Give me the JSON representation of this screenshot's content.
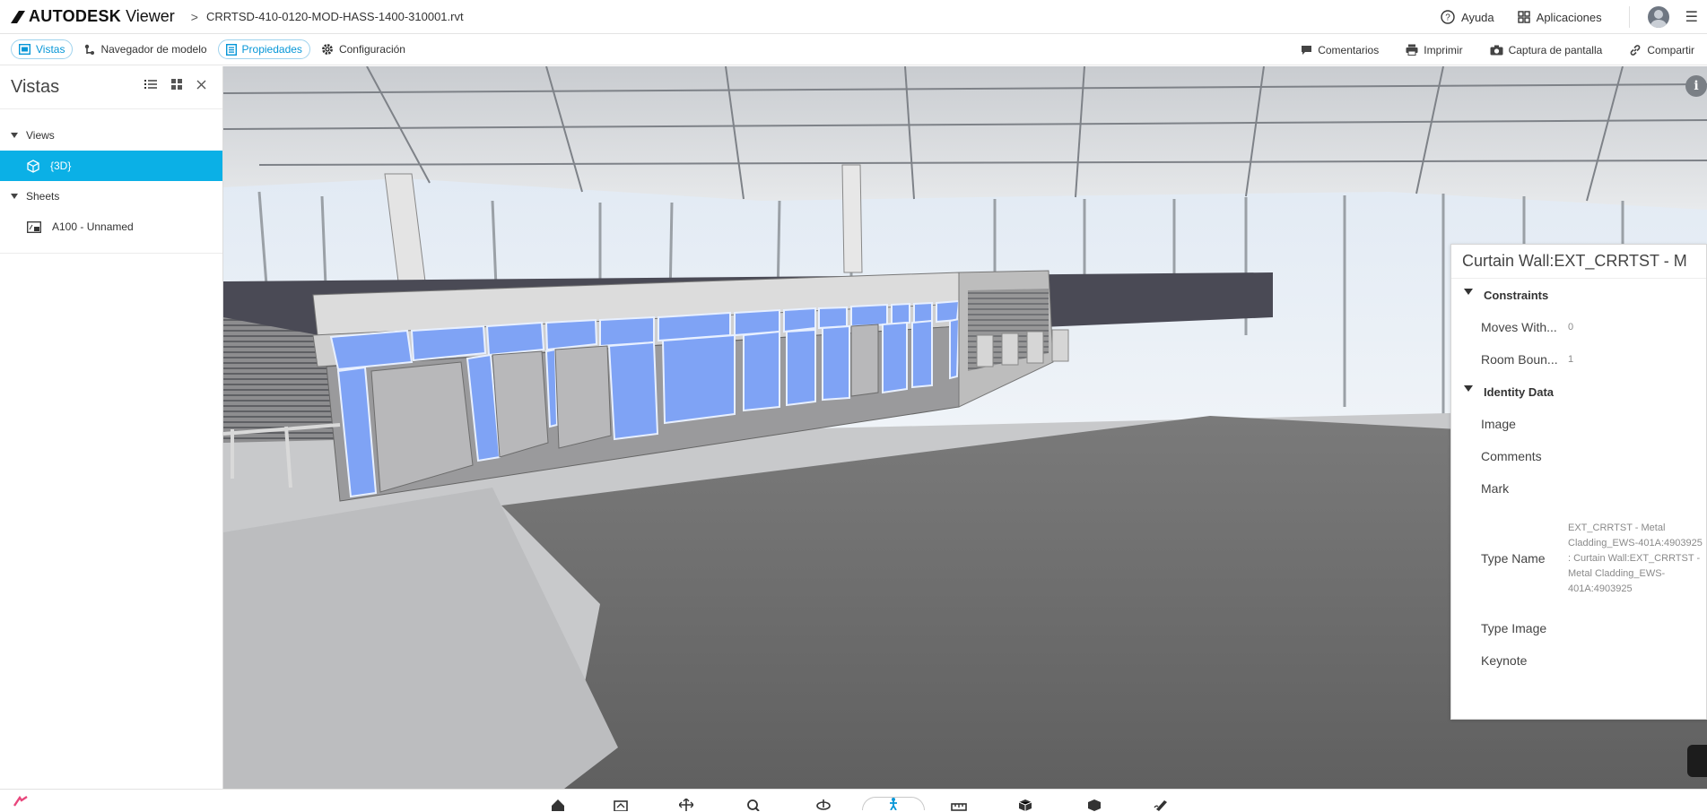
{
  "app": {
    "brand": "AUTODESK",
    "product": "Viewer",
    "breadcrumb_separator": ">",
    "filename": "CRRTSD-410-0120-MOD-HASS-1400-310001.rvt"
  },
  "topbar": {
    "help_label": "Ayuda",
    "apps_label": "Aplicaciones"
  },
  "toolbar": {
    "left": [
      {
        "label": "Vistas",
        "icon": "views-icon",
        "active": true
      },
      {
        "label": "Navegador de modelo",
        "icon": "model-browser-icon",
        "active": false
      },
      {
        "label": "Propiedades",
        "icon": "properties-icon",
        "active": true
      },
      {
        "label": "Configuración",
        "icon": "gear-icon",
        "active": false
      }
    ],
    "right": [
      {
        "label": "Comentarios",
        "icon": "comment-icon"
      },
      {
        "label": "Imprimir",
        "icon": "print-icon"
      },
      {
        "label": "Captura de pantalla",
        "icon": "camera-icon"
      },
      {
        "label": "Compartir",
        "icon": "link-icon"
      }
    ]
  },
  "views_panel": {
    "title": "Vistas",
    "groups": [
      {
        "label": "Views",
        "items": [
          {
            "label": "{3D}",
            "icon": "cube-icon",
            "selected": true
          }
        ]
      },
      {
        "label": "Sheets",
        "items": [
          {
            "label": "A100 - Unnamed",
            "icon": "sheet-icon",
            "selected": false
          }
        ]
      }
    ]
  },
  "properties": {
    "title": "Curtain Wall:EXT_CRRTST - M",
    "groups": [
      {
        "label": "Constraints",
        "rows": [
          {
            "key": "Moves With...",
            "value": "0"
          },
          {
            "key": "Room Boun...",
            "value": "1"
          }
        ]
      },
      {
        "label": "Identity Data",
        "rows": [
          {
            "key": "Image",
            "value": ""
          },
          {
            "key": "Comments",
            "value": ""
          },
          {
            "key": "Mark",
            "value": ""
          },
          {
            "key": "Type Name",
            "value": "EXT_CRRTST - Metal Cladding_EWS-401A:4903925 : Curtain Wall:EXT_CRRTST - Metal Cladding_EWS-401A:4903925"
          },
          {
            "key": "Type Image",
            "value": ""
          },
          {
            "key": "Keynote",
            "value": ""
          }
        ]
      }
    ]
  },
  "bottom_toolbar": {
    "tools": [
      "home-icon",
      "section-icon",
      "pan-icon",
      "zoom-icon",
      "orbit-icon",
      "walk-icon",
      "measure-icon",
      "explode-icon",
      "model-icon",
      "markup-icon"
    ],
    "active": "walk-icon"
  },
  "colors": {
    "accent": "#0696d7",
    "selection": "#0bb0e6",
    "highlight": "#7fa3f5"
  }
}
